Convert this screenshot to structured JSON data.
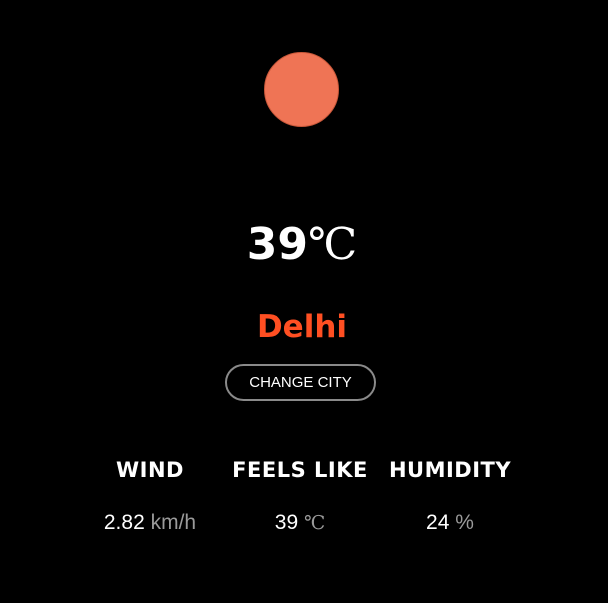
{
  "weather": {
    "icon": "sun-icon",
    "temperature_value": "39",
    "temperature_unit": "℃",
    "city": "Delhi"
  },
  "actions": {
    "change_city_label": "CHANGE CITY"
  },
  "stats": {
    "wind": {
      "label": "WIND",
      "value": "2.82",
      "unit": "km/h"
    },
    "feels_like": {
      "label": "FEELS LIKE",
      "value": "39",
      "unit": "℃"
    },
    "humidity": {
      "label": "HUMIDITY",
      "value": "24",
      "unit": "%"
    }
  },
  "colors": {
    "background": "#000000",
    "sun": "#ef7455",
    "city": "#ff4f22",
    "text": "#ffffff",
    "muted": "#9a9a9a",
    "button_border": "#8a8a8a"
  }
}
